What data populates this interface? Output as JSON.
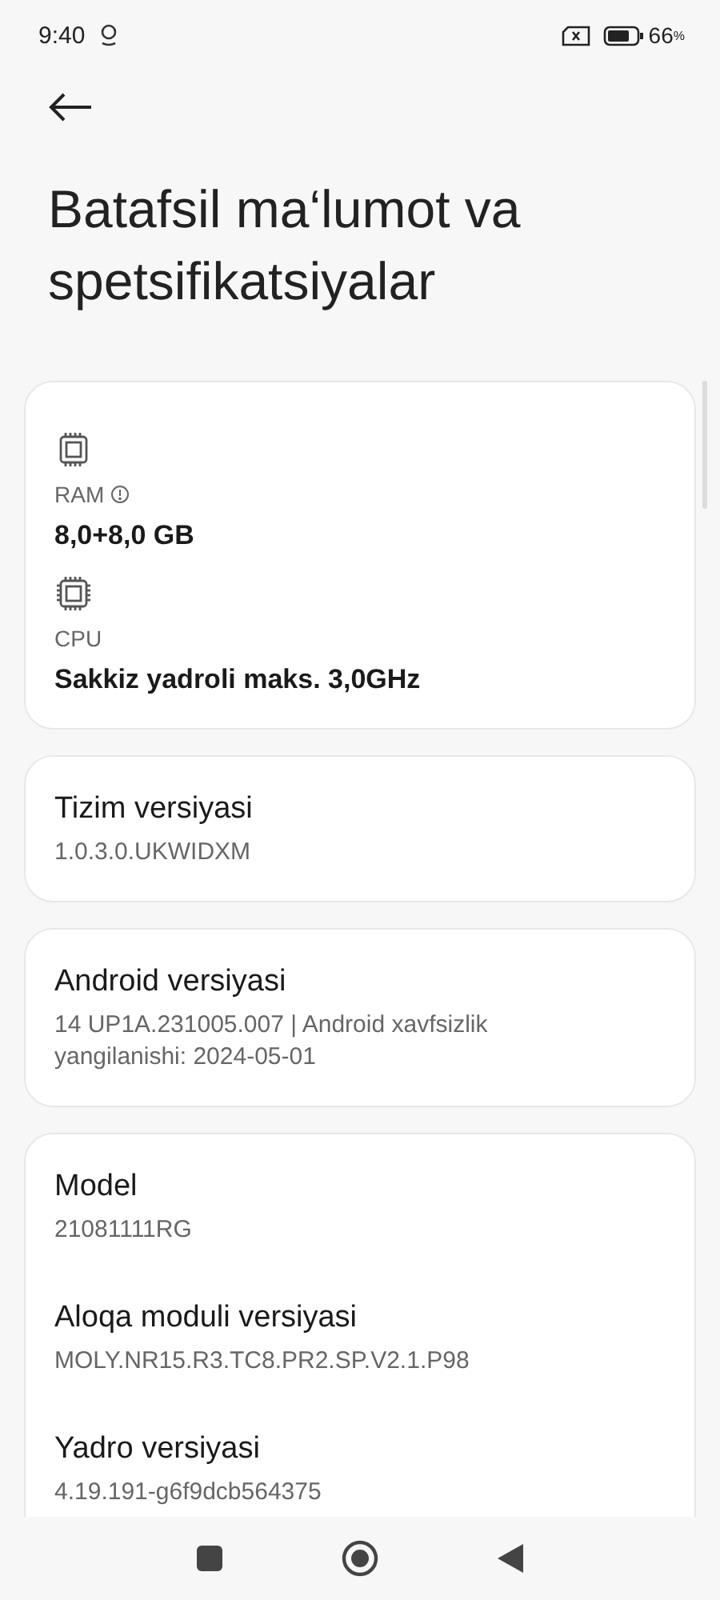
{
  "status_bar": {
    "time": "9:40",
    "battery": "66",
    "percent_sign": "%"
  },
  "title": "Batafsil ma‘lumot va spetsifikatsiyalar",
  "hardware": [
    {
      "label": "RAM",
      "info": true,
      "value": "8,0+8,0 GB"
    },
    {
      "label": "CPU",
      "info": false,
      "value": "Sakkiz yadroli maks. 3,0GHz"
    }
  ],
  "cards": [
    {
      "items": [
        {
          "title": "Tizim versiyasi",
          "value": "1.0.3.0.UKWIDXM"
        }
      ]
    },
    {
      "items": [
        {
          "title": "Android versiyasi",
          "value": "14 UP1A.231005.007 | Android xavfsizlik yangilanishi: 2024-05-01"
        }
      ]
    },
    {
      "items": [
        {
          "title": "Model",
          "value": "21081111RG"
        },
        {
          "title": "Aloqa moduli versiyasi",
          "value": "MOLY.NR15.R3.TC8.PR2.SP.V2.1.P98"
        },
        {
          "title": "Yadro versiyasi",
          "value": "4.19.191-g6f9dcb564375"
        }
      ]
    }
  ]
}
